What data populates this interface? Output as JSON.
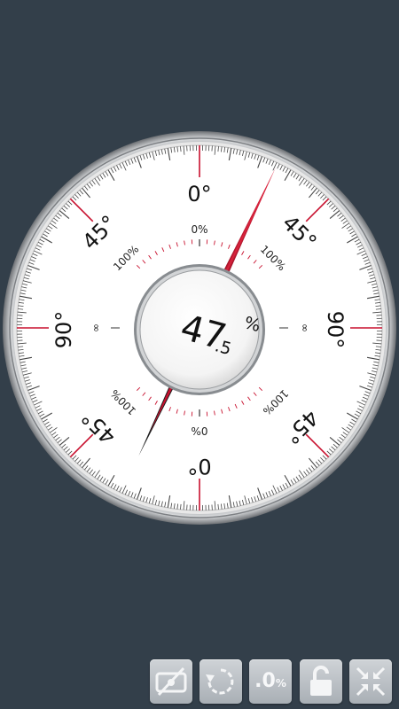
{
  "dial": {
    "ring_labels": {
      "top": "0°",
      "upper_left": "45°",
      "upper_right": "45°",
      "left": "90°",
      "right": "90°",
      "lower_left": "45°",
      "lower_right": "45°",
      "bottom": "0°"
    },
    "inner_labels": {
      "top_zero": "0%",
      "top_left_hundred": "100%",
      "top_right_hundred": "100%",
      "bottom_zero": "0%",
      "bottom_left_hundred": "100%",
      "bottom_right_hundred": "100%",
      "left_infinity": "∞",
      "right_infinity": "∞"
    },
    "reading": {
      "integer": "47",
      "decimal": ".5",
      "unit": "%"
    },
    "needle_angle_deg": 25.4,
    "colors": {
      "background": "#333f4a",
      "face": "#ffffff",
      "accent_red": "#c8102e",
      "tick": "#333333"
    }
  },
  "toolbar": {
    "buttons": [
      {
        "name": "calibrate-button",
        "icon": "level-off-icon"
      },
      {
        "name": "rotate-button",
        "icon": "rotate-icon"
      },
      {
        "name": "precision-button",
        "icon": "precision-icon",
        "label": ".0",
        "unit": "%"
      },
      {
        "name": "lock-button",
        "icon": "unlock-icon"
      },
      {
        "name": "fullscreen-button",
        "icon": "collapse-icon"
      }
    ]
  }
}
